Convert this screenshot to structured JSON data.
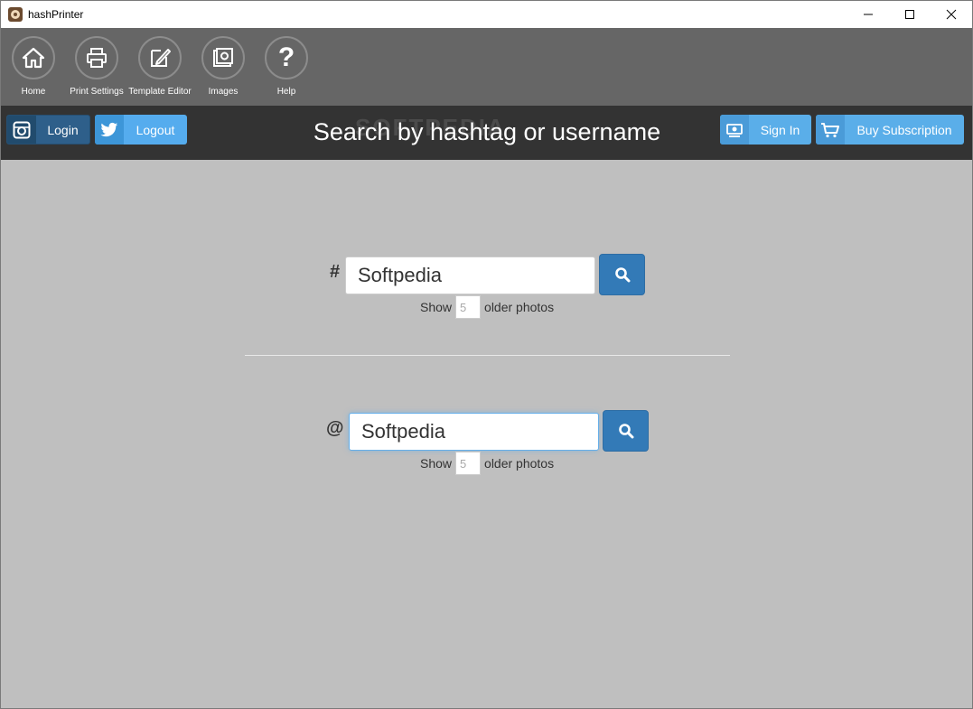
{
  "window": {
    "title": "hashPrinter"
  },
  "toolbar": {
    "items": [
      {
        "label": "Home",
        "icon": "home-icon"
      },
      {
        "label": "Print Settings",
        "icon": "printer-icon"
      },
      {
        "label": "Template Editor",
        "icon": "template-edit-icon"
      },
      {
        "label": "Images",
        "icon": "images-icon"
      },
      {
        "label": "Help",
        "icon": "help-icon"
      }
    ]
  },
  "header": {
    "title": "Search by hashtag or username",
    "watermark": "SOFTPEDIA",
    "login_label": "Login",
    "logout_label": "Logout",
    "signin_label": "Sign In",
    "buy_label": "Buy Subscription"
  },
  "hashtag_search": {
    "prefix": "#",
    "value": "Softpedia",
    "show_label": "Show",
    "older_count": "5",
    "older_label": "older photos"
  },
  "username_search": {
    "prefix": "@",
    "value": "Softpedia",
    "show_label": "Show",
    "older_count": "5",
    "older_label": "older photos"
  },
  "colors": {
    "toolbar_bg": "#666666",
    "header_bg": "#333333",
    "content_bg": "#bfbfbf",
    "primary_button": "#337ab7",
    "twitter_blue": "#55acee"
  }
}
